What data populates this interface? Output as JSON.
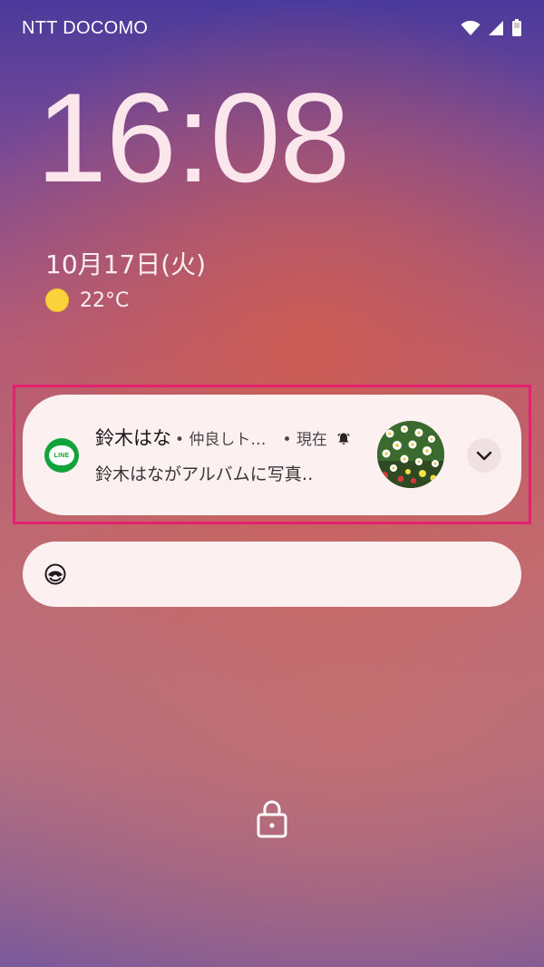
{
  "status_bar": {
    "carrier": "NTT DOCOMO",
    "icons": [
      "wifi-icon",
      "cell-signal-icon",
      "battery-icon"
    ]
  },
  "lock_screen": {
    "time": "16:08",
    "date": "10月17日(火)",
    "weather": {
      "icon": "sun-icon",
      "temperature": "22°C"
    }
  },
  "notifications": [
    {
      "app_icon": "line-app-icon",
      "app_icon_text": "LINE",
      "sender": "鈴木はな",
      "group": "• 仲良しト…",
      "time": "• 現在",
      "alert_icon": "bell-icon",
      "message": "鈴木はながアルバムに写真‥",
      "thumbnail": "flower-photo",
      "expand_icon": "chevron-down-icon"
    },
    {
      "app_icon": "app-badge-icon"
    }
  ],
  "bottom": {
    "lock_icon": "lock-icon"
  },
  "colors": {
    "highlight": "#e5206e",
    "card_bg": "#fcf1f0",
    "clock": "#fbe6ec",
    "line_green": "#10a43a",
    "sun": "#fbd23c"
  }
}
